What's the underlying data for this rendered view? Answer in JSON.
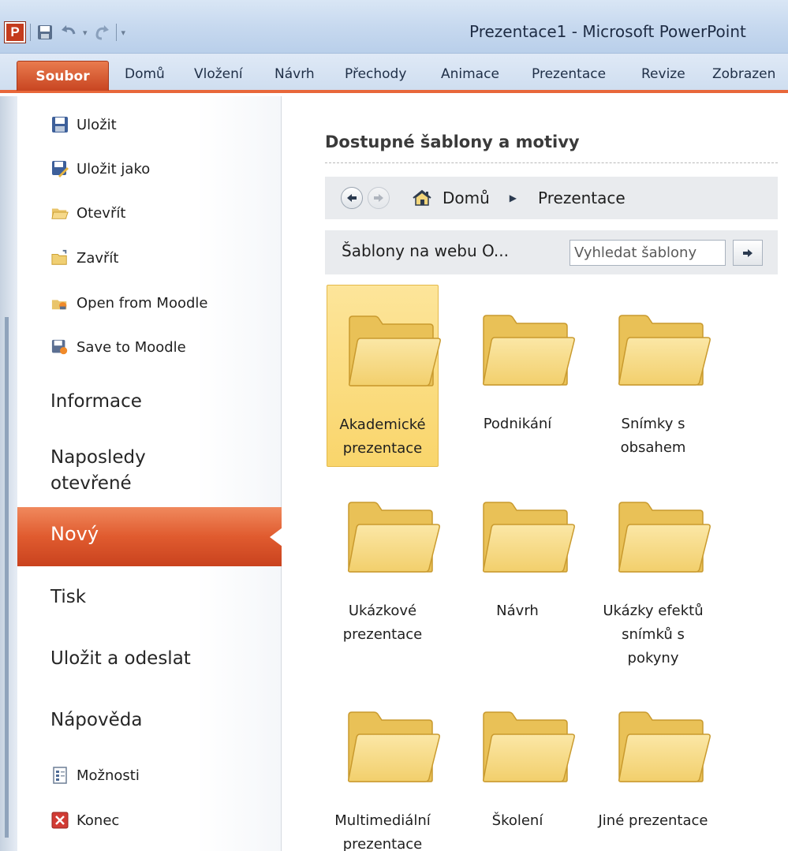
{
  "window": {
    "title": "Prezentace1  -  Microsoft PowerPoint"
  },
  "quick_access": {
    "app_icon_letter": "P"
  },
  "ribbon": {
    "file_tab": "Soubor",
    "tabs": [
      "Domů",
      "Vložení",
      "Návrh",
      "Přechody",
      "Animace",
      "Prezentace",
      "Revize",
      "Zobrazen"
    ]
  },
  "nav": {
    "commands_top": [
      {
        "label": "Uložit",
        "icon": "save-icon"
      },
      {
        "label": "Uložit jako",
        "icon": "save-as-icon"
      },
      {
        "label": "Otevřít",
        "icon": "open-folder-icon"
      },
      {
        "label": "Zavřít",
        "icon": "close-folder-icon"
      },
      {
        "label": "Open from Moodle",
        "icon": "moodle-open-icon"
      },
      {
        "label": "Save to Moodle",
        "icon": "moodle-save-icon"
      }
    ],
    "sections": {
      "info": "Informace",
      "recent": "Naposledy otevřené",
      "new": "Nový",
      "print": "Tisk",
      "save_send": "Uložit a odeslat",
      "help": "Nápověda"
    },
    "commands_bottom": [
      {
        "label": "Možnosti",
        "icon": "options-icon"
      },
      {
        "label": "Konec",
        "icon": "exit-icon"
      }
    ]
  },
  "main": {
    "title": "Dostupné šablony a motivy",
    "breadcrumb": {
      "home": "Domů",
      "current": "Prezentace"
    },
    "search": {
      "label": "Šablony na webu O...",
      "placeholder": "Vyhledat šablony"
    },
    "tiles": [
      {
        "label": "Akademické prezentace",
        "selected": true
      },
      {
        "label": "Podnikání",
        "selected": false
      },
      {
        "label": "Snímky s obsahem",
        "selected": false
      },
      {
        "label": "Ukázkové prezentace",
        "selected": false
      },
      {
        "label": "Návrh",
        "selected": false
      },
      {
        "label": "Ukázky efektů snímků s pokyny",
        "selected": false
      },
      {
        "label": "Multimediální prezentace",
        "selected": false
      },
      {
        "label": "Školení",
        "selected": false
      },
      {
        "label": "Jiné prezentace",
        "selected": false
      }
    ]
  },
  "colors": {
    "accent": "#e05b2f",
    "selection": "#f9d56b"
  }
}
